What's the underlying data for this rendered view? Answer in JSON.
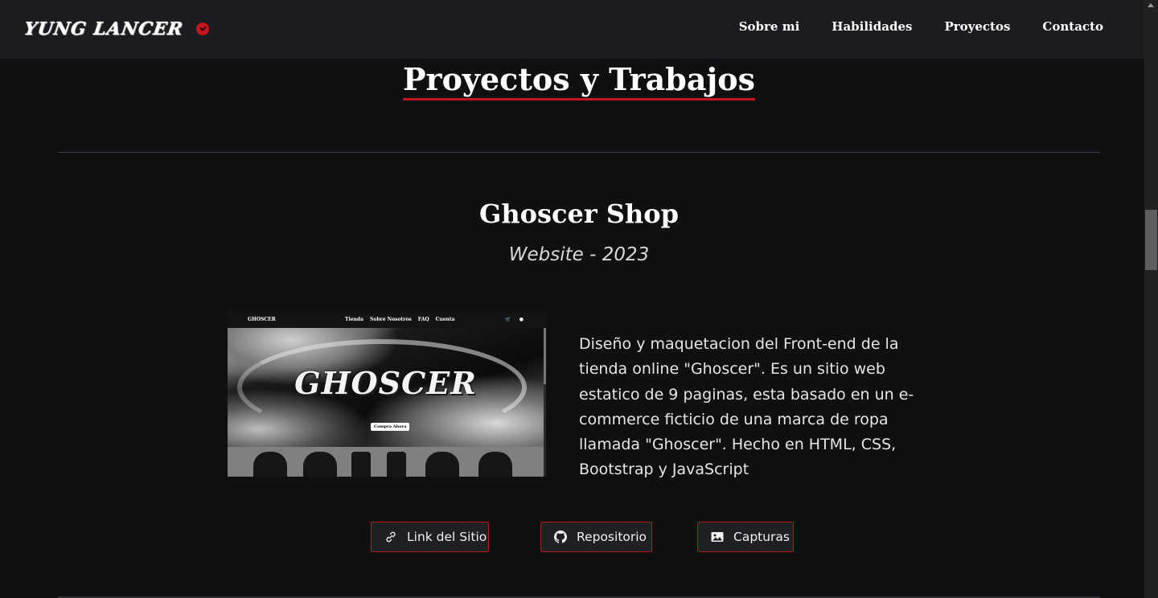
{
  "nav": {
    "brand": "YUNG LANCER",
    "links": [
      "Sobre mi",
      "Habilidades",
      "Proyectos",
      "Contacto"
    ]
  },
  "section": {
    "title": "Proyectos y Trabajos"
  },
  "project": {
    "title": "Ghoscer Shop",
    "subtitle": "Website - 2023",
    "description": "Diseño y maquetacion del Front-end de la tienda online \"Ghoscer\". Es un sitio web estatico de 9 paginas, esta basado en un e-commerce ficticio de una marca de ropa llamada \"Ghoscer\". Hecho en HTML, CSS, Bootstrap y JavaScript",
    "preview": {
      "logo": "GHOSCER",
      "nav_items": [
        "Tienda",
        "Sobre Nosotros",
        "FAQ",
        "Cuenta"
      ],
      "hero_text": "GHOSCER",
      "cta": "Compra Ahora"
    },
    "buttons": {
      "site": "Link del Sitio",
      "repo": "Repositorio",
      "shots": "Capturas"
    }
  },
  "colors": {
    "accent": "#c4161c",
    "background": "#0f1012",
    "navbar": "#1b1c1f"
  },
  "icons": {
    "site": "link-icon",
    "repo": "github-icon",
    "shots": "image-icon",
    "brand_badge": "verified-badge-icon"
  }
}
